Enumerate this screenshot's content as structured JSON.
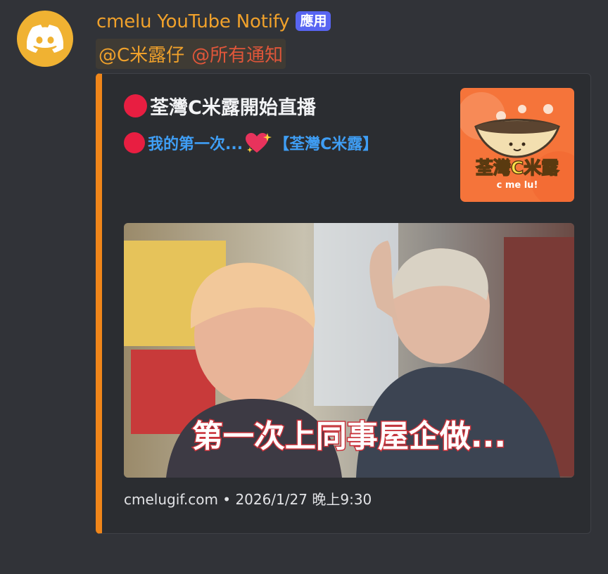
{
  "message": {
    "username": "cmelu YouTube Notify",
    "app_badge": "應用",
    "mention_1": "@C米露仔",
    "mention_2": "@所有通知"
  },
  "embed": {
    "title": "荃灣C米露開始直播",
    "description_text": "我的第一次...",
    "description_channel": "【荃灣C米露】",
    "thumbnail_title": "荃灣C米露",
    "thumbnail_subtitle": "c me lu!",
    "image_caption": "第一次上同事屋企做...",
    "footer_site": "cmelugif.com",
    "footer_sep": "•",
    "footer_time": "2026/1/27 晚上9:30"
  },
  "colors": {
    "background": "#313338",
    "embed_bg": "#2b2d31",
    "accent_bar": "#f0861a",
    "username": "#f0a12b",
    "link_blue": "#3f9ef5",
    "live_red": "#e81e41",
    "badge": "#5865f2"
  }
}
